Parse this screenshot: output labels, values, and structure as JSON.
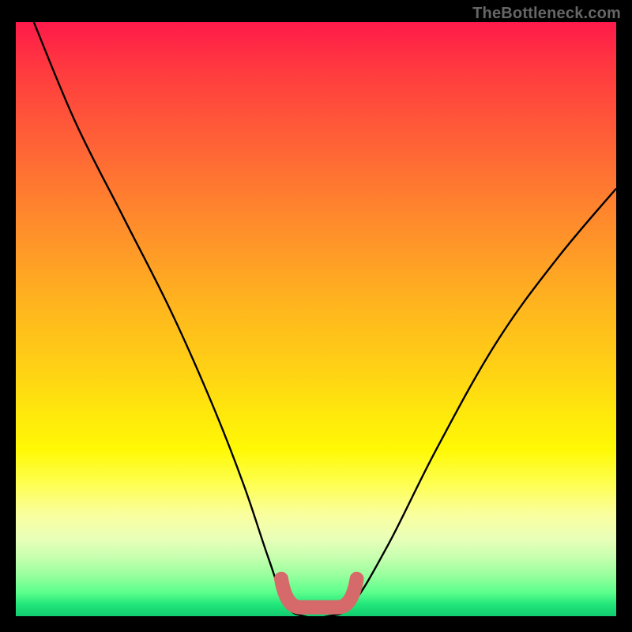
{
  "attribution": "TheBottleneck.com",
  "chart_data": {
    "type": "line",
    "title": "",
    "xlabel": "",
    "ylabel": "",
    "ylim": [
      0,
      100
    ],
    "xlim": [
      0,
      100
    ],
    "series": [
      {
        "name": "bottleneck-curve",
        "x": [
          3,
          10,
          18,
          26,
          33,
          38,
          42,
          45,
          48,
          52,
          56,
          62,
          70,
          80,
          90,
          100
        ],
        "values": [
          100,
          83,
          67,
          51,
          35,
          22,
          10,
          2,
          0,
          0,
          2,
          12,
          28,
          46,
          60,
          72
        ]
      }
    ],
    "flat_zone": {
      "x_start": 45,
      "x_end": 56,
      "y": 1.5
    },
    "colors": {
      "curve": "#000000",
      "flat_zone": "#d66a6a",
      "gradient_top": "#ff1a4a",
      "gradient_bottom": "#12cc6f",
      "background": "#000000",
      "attribution_text": "#666666"
    }
  }
}
